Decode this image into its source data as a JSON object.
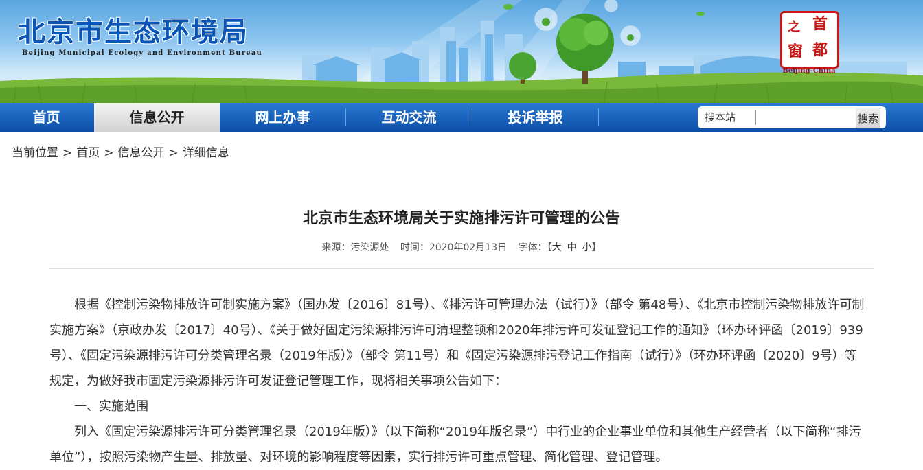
{
  "header": {
    "title": "北京市生态环境局",
    "subtitle": "Beijing Municipal Ecology and Environment Bureau",
    "logo": {
      "chars": [
        "首",
        "都",
        "之",
        "窗"
      ],
      "caption": "Beijing-China"
    }
  },
  "nav": {
    "items": [
      {
        "label": "首页"
      },
      {
        "label": "信息公开"
      },
      {
        "label": "网上办事"
      },
      {
        "label": "互动交流"
      },
      {
        "label": "投诉举报"
      }
    ],
    "active": 1,
    "search": {
      "label": "搜本站",
      "placeholder": "",
      "button": "搜索"
    }
  },
  "breadcrumb": {
    "prefix": "当前位置",
    "items": [
      "首页",
      "信息公开",
      "详细信息"
    ]
  },
  "article": {
    "title": "北京市生态环境局关于实施排污许可管理的公告",
    "source_label": "来源：",
    "source": "污染源处",
    "time_label": "时间：",
    "time": "2020年02月13日",
    "font_label": "字体：",
    "font_open": "【",
    "font_sizes": [
      "大",
      "中",
      "小"
    ],
    "font_close": "】",
    "paragraphs": [
      "根据《控制污染物排放许可制实施方案》（国办发〔2016〕81号）、《排污许可管理办法（试行）》（部令 第48号）、《北京市控制污染物排放许可制实施方案》（京政办发〔2017〕40号）、《关于做好固定污染源排污许可清理整顿和2020年排污许可发证登记工作的通知》（环办环评函〔2019〕939号）、《固定污染源排污许可分类管理名录（2019年版）》（部令 第11号）和《固定污染源排污登记工作指南（试行）》（环办环评函〔2020〕9号）等规定，为做好我市固定污染源排污许可发证登记管理工作，现将相关事项公告如下：",
      "一、实施范围",
      "列入《固定污染源排污许可分类管理名录（2019年版）》（以下简称“2019年版名录”）中行业的企业事业单位和其他生产经营者（以下简称“排污单位”），按照污染物产生量、排放量、对环境的影响程度等因素，实行排污许可重点管理、简化管理、登记管理。"
    ]
  },
  "colors": {
    "brand_blue": "#0a55b5",
    "nav_blue": "#1560bd",
    "logo_red": "#c81818"
  }
}
